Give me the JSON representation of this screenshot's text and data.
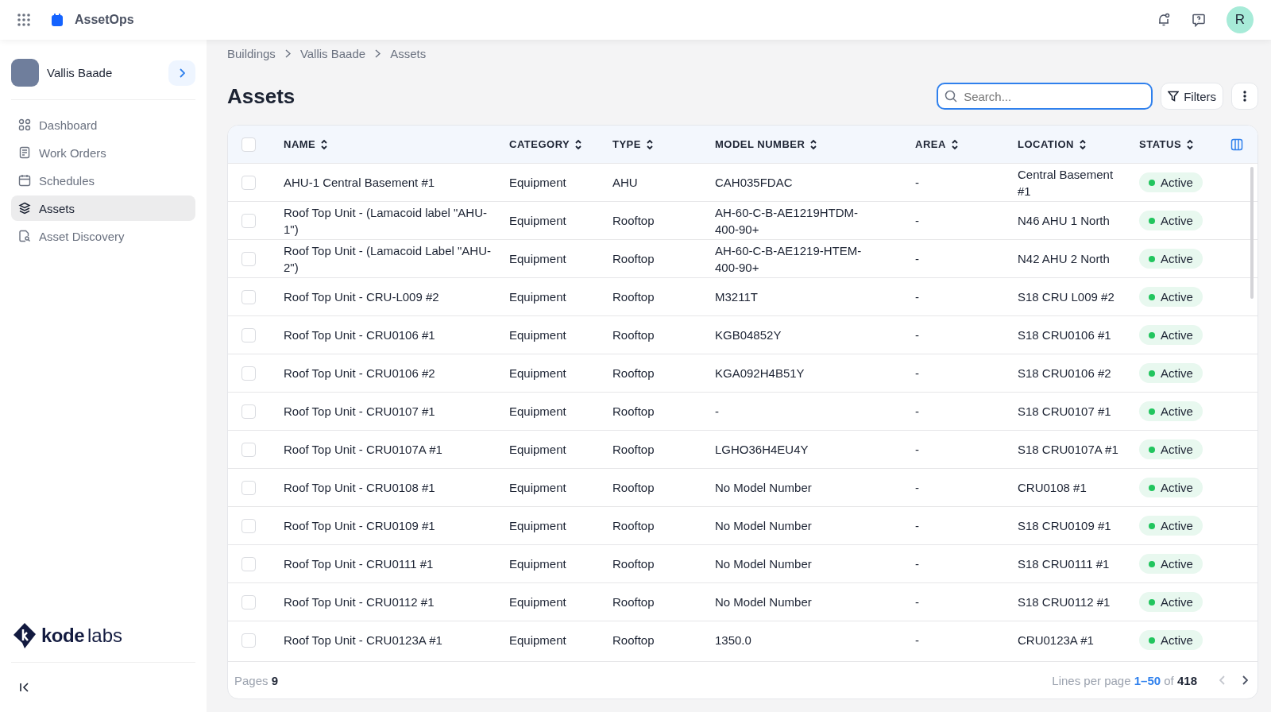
{
  "app": {
    "name": "AssetOps",
    "avatar_letter": "R"
  },
  "building": {
    "name": "Vallis Baade"
  },
  "sidebar": {
    "items": [
      {
        "label": "Dashboard",
        "selected": false
      },
      {
        "label": "Work Orders",
        "selected": false
      },
      {
        "label": "Schedules",
        "selected": false
      },
      {
        "label": "Assets",
        "selected": true
      },
      {
        "label": "Asset Discovery",
        "selected": false
      }
    ],
    "logo": {
      "mark": "kode",
      "rest": "labs"
    }
  },
  "breadcrumbs": [
    "Buildings",
    "Vallis Baade",
    "Assets"
  ],
  "page_title": "Assets",
  "search": {
    "placeholder": "Search..."
  },
  "filters_button": "Filters",
  "table": {
    "all_checked": false,
    "columns": [
      "NAME",
      "CATEGORY",
      "TYPE",
      "MODEL NUMBER",
      "AREA",
      "LOCATION",
      "STATUS"
    ],
    "rows": [
      {
        "checked": false,
        "cells": [
          "AHU-1 Central Basement #1",
          "Equipment",
          "AHU",
          "CAH035FDAC",
          "-",
          "Central Basement #1"
        ],
        "status": "Active"
      },
      {
        "checked": false,
        "cells": [
          "Roof Top Unit - (Lamacoid label \"AHU-1\")",
          "Equipment",
          "Rooftop",
          "AH-60-C-B-AE1219HTDM-400-90+",
          "-",
          "N46 AHU 1 North"
        ],
        "status": "Active"
      },
      {
        "checked": false,
        "cells": [
          "Roof Top Unit - (Lamacoid Label \"AHU-2\")",
          "Equipment",
          "Rooftop",
          "AH-60-C-B-AE1219-HTEM-400-90+",
          "-",
          "N42 AHU 2 North"
        ],
        "status": "Active"
      },
      {
        "checked": false,
        "cells": [
          "Roof Top Unit - CRU-L009 #2",
          "Equipment",
          "Rooftop",
          "M3211T",
          "-",
          "S18 CRU L009 #2"
        ],
        "status": "Active"
      },
      {
        "checked": false,
        "cells": [
          "Roof Top Unit - CRU0106 #1",
          "Equipment",
          "Rooftop",
          "KGB04852Y",
          "-",
          "S18 CRU0106 #1"
        ],
        "status": "Active"
      },
      {
        "checked": false,
        "cells": [
          "Roof Top Unit - CRU0106 #2",
          "Equipment",
          "Rooftop",
          "KGA092H4B51Y",
          "-",
          "S18 CRU0106 #2"
        ],
        "status": "Active"
      },
      {
        "checked": false,
        "cells": [
          "Roof Top Unit - CRU0107 #1",
          "Equipment",
          "Rooftop",
          "-",
          "-",
          "S18 CRU0107 #1"
        ],
        "status": "Active"
      },
      {
        "checked": false,
        "cells": [
          "Roof Top Unit - CRU0107A #1",
          "Equipment",
          "Rooftop",
          "LGHO36H4EU4Y",
          "-",
          "S18 CRU0107A #1"
        ],
        "status": "Active"
      },
      {
        "checked": false,
        "cells": [
          "Roof Top Unit - CRU0108 #1",
          "Equipment",
          "Rooftop",
          "No Model Number",
          "-",
          "CRU0108 #1"
        ],
        "status": "Active"
      },
      {
        "checked": false,
        "cells": [
          "Roof Top Unit - CRU0109 #1",
          "Equipment",
          "Rooftop",
          "No Model Number",
          "-",
          "S18 CRU0109 #1"
        ],
        "status": "Active"
      },
      {
        "checked": false,
        "cells": [
          "Roof Top Unit - CRU0111 #1",
          "Equipment",
          "Rooftop",
          "No Model Number",
          "-",
          "S18 CRU0111 #1"
        ],
        "status": "Active"
      },
      {
        "checked": false,
        "cells": [
          "Roof Top Unit - CRU0112 #1",
          "Equipment",
          "Rooftop",
          "No Model Number",
          "-",
          "S18 CRU0112 #1"
        ],
        "status": "Active"
      },
      {
        "checked": false,
        "cells": [
          "Roof Top Unit - CRU0123A #1",
          "Equipment",
          "Rooftop",
          "1350.0",
          "-",
          "CRU0123A #1"
        ],
        "status": "Active"
      }
    ]
  },
  "footer": {
    "pages_label": "Pages",
    "pages_count": "9",
    "lines_label": "Lines per page",
    "range": "1–50",
    "of": "of",
    "total": "418"
  }
}
